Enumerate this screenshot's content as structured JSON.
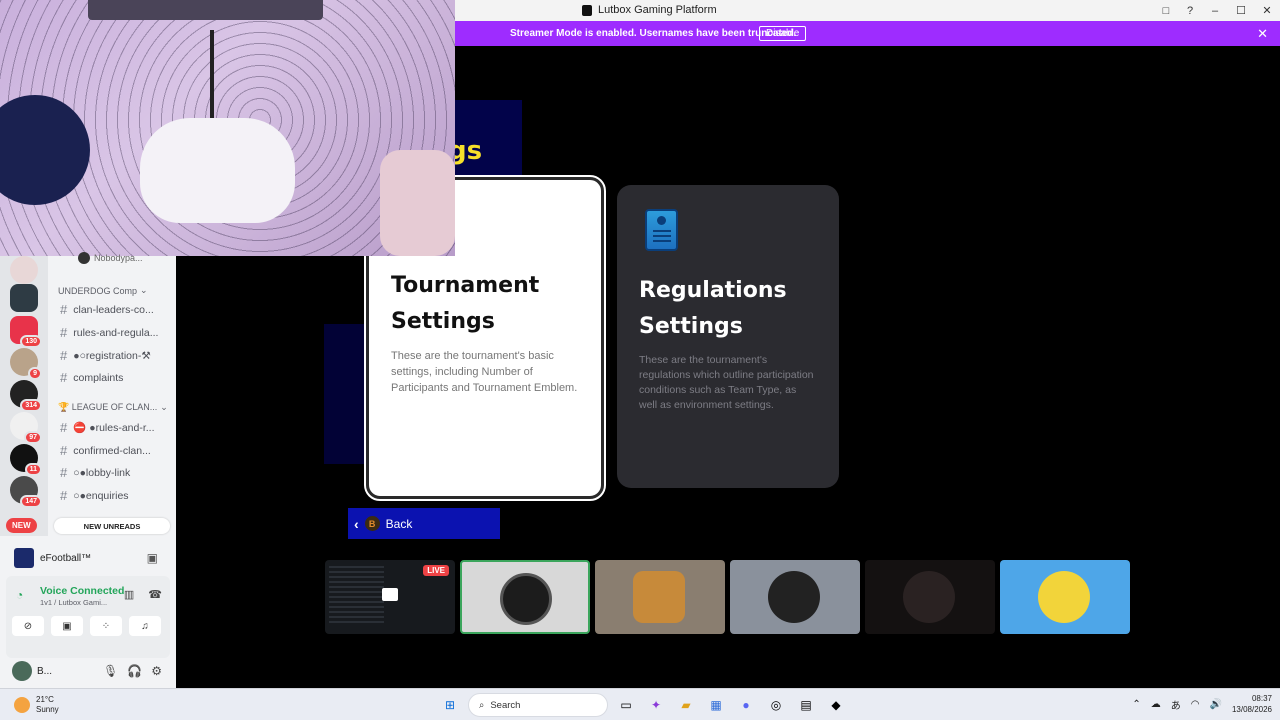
{
  "window": {
    "title": "Lutbox Gaming Platform",
    "controls": [
      "□",
      "?",
      "–",
      "☐",
      "✕"
    ]
  },
  "banner": {
    "text": "Streamer Mode is enabled. Usernames have been truncated.",
    "disable_label": "Disable",
    "close": "✕",
    "color": "#9e2cff"
  },
  "game": {
    "heading_fragment": "gs",
    "cards": [
      {
        "title_line1": "Tournament",
        "title_line2": "Settings",
        "description": "These are the tournament's basic settings, including Number of Participants and Tournament Emblem."
      },
      {
        "title_line1": "Regulations",
        "title_line2": "Settings",
        "description": "These are the tournament's regulations which outline participation conditions such as Team Type, as well as environment settings."
      }
    ],
    "back": {
      "badge": "B",
      "label": "Back"
    },
    "stream_tiles": [
      {
        "type": "screen-share",
        "live_label": "LIVE"
      },
      {
        "type": "avatar"
      },
      {
        "type": "avatar"
      },
      {
        "type": "avatar"
      },
      {
        "type": "avatar"
      },
      {
        "type": "avatar"
      }
    ]
  },
  "discord": {
    "top_user": "Nobodypa...",
    "categories": [
      {
        "name": "UNDERDOG Comp",
        "channels": [
          "clan-leaders-co...",
          "rules-and-regula...",
          "●○registration-⚒",
          "complaints"
        ]
      },
      {
        "name": "🏆 LEAGUE OF CLAN...",
        "channels": [
          "⛔ ●rules-and-r...",
          "confirmed-clan...",
          "○●lobby-link",
          "○●enquiries"
        ]
      }
    ],
    "server_badges": [
      "130",
      "9",
      "314",
      "97",
      "11",
      "147"
    ],
    "new_pill": "NEW",
    "new_unreads": "NEW UNREADS",
    "activity": "eFootball™",
    "voice": {
      "status": "Voice Connected",
      "channel": "1v1 / Lutbox Gami..."
    },
    "user": {
      "name": "B..."
    }
  },
  "taskbar": {
    "weather_temp": "21°C",
    "weather_desc": "Sunny",
    "search_label": "Search",
    "time": "08:37",
    "date": "13/08/2026"
  }
}
